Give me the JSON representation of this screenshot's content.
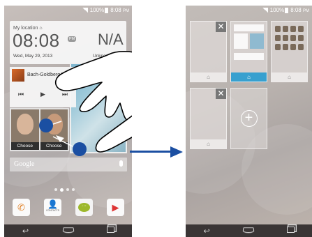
{
  "left_screen": {
    "status": {
      "battery": "100%",
      "time": "8:08",
      "ampm": "PM"
    },
    "weather": {
      "location": "My location",
      "time": "08:08",
      "ampm": "PM",
      "date": "Wed, May 29, 2013",
      "condition": "N/A",
      "city": "Unknown"
    },
    "music": {
      "track": "Bach-Goldberg V"
    },
    "contacts": [
      {
        "label": "Choose"
      },
      {
        "label": "Choose"
      }
    ],
    "search": {
      "label": "Google"
    },
    "page_indicator": {
      "pages": 4,
      "active": 1
    },
    "dock": [
      {
        "name": "Phone",
        "icon": "phone-icon"
      },
      {
        "name": "Contacts",
        "icon": "contacts-icon",
        "label": "CONTACTS"
      },
      {
        "name": "Messaging",
        "icon": "message-icon",
        "glyph": "···"
      },
      {
        "name": "Play Store",
        "icon": "store-icon"
      }
    ]
  },
  "right_screen": {
    "status": {
      "battery": "100%",
      "time": "8:08",
      "ampm": "PM"
    },
    "pages": [
      {
        "content": "blank",
        "closable": true,
        "active": false
      },
      {
        "content": "widgets",
        "closable": false,
        "active": true
      },
      {
        "content": "apps",
        "closable": false,
        "active": false
      },
      {
        "content": "blank",
        "closable": true,
        "active": false
      },
      {
        "content": "add",
        "closable": false,
        "active": false
      }
    ]
  },
  "colors": {
    "accent": "#37a0cf",
    "gesture": "#1b4fa2"
  }
}
